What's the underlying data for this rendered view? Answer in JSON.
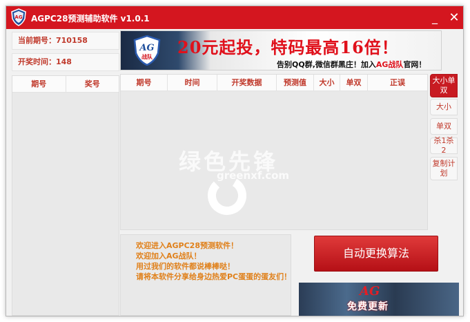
{
  "window": {
    "title": "AGPC28预测辅助软件 v1.0.1",
    "minimize_glyph": "_",
    "close_glyph": "✕"
  },
  "info": {
    "current_issue": "当前期号：710158",
    "draw_time": "开奖时间：148"
  },
  "left_table": {
    "columns": [
      "期号",
      "奖号"
    ]
  },
  "banner": {
    "badge_text": "AG",
    "badge_sub": "战队",
    "slogan": "20元起投，特码最高16倍！",
    "sub_prefix": "告别QQ群,微信群黑庄！加入",
    "sub_highlight": "AG战队",
    "sub_suffix": "官网！"
  },
  "grid": {
    "columns": [
      "期号",
      "时间",
      "开奖数据",
      "预测值",
      "大小",
      "单双",
      "正误"
    ]
  },
  "tabs": [
    {
      "label": "大小单双",
      "active": true
    },
    {
      "label": "大小",
      "active": false
    },
    {
      "label": "单双",
      "active": false
    },
    {
      "label": "杀1杀2",
      "active": false
    },
    {
      "label": "复制计划",
      "active": false
    }
  ],
  "messages": [
    "欢迎进入AGPC28预测软件！",
    "欢迎加入AG战队！",
    "用过我们的软件都说棒棒哒！",
    "请将本软件分享给身边热爱PC蛋蛋的蛋友们！"
  ],
  "algo_button": "自动更换算法",
  "ad": {
    "brand": "AG",
    "text": "免费更新"
  },
  "watermark": {
    "cn": "绿色先锋",
    "url": "greenxf.com"
  },
  "colors": {
    "titlebar": "#d4161f",
    "accent": "#c0392b",
    "message": "#e0801a"
  }
}
